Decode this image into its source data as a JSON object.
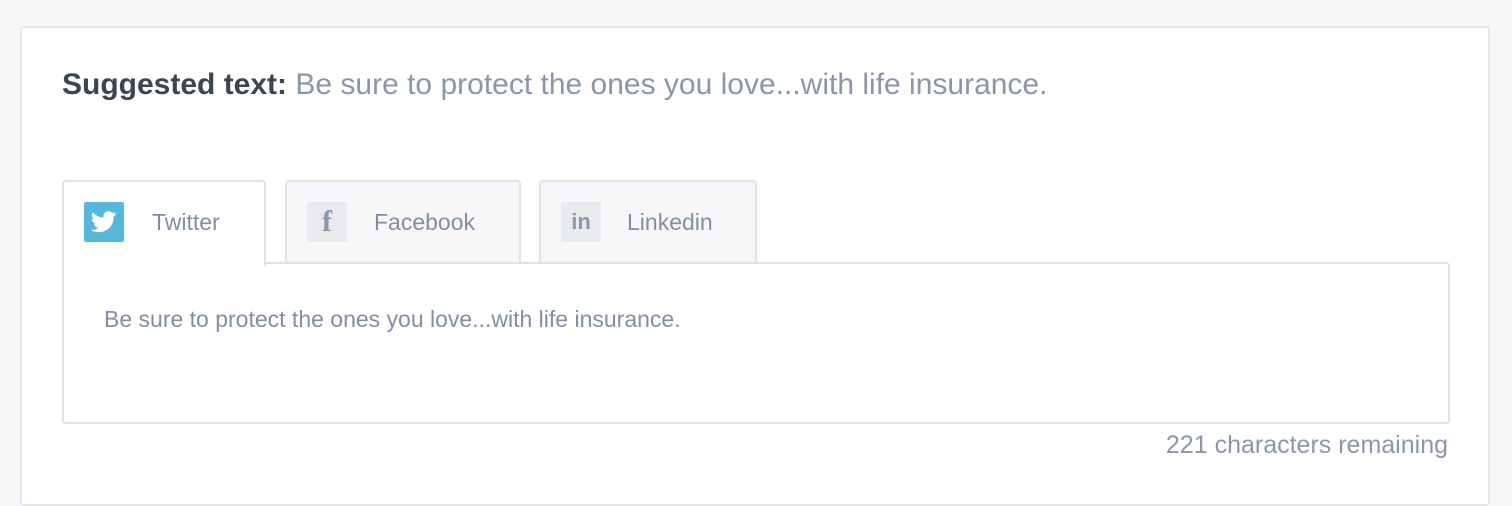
{
  "suggested": {
    "label": "Suggested text:",
    "text": "Be sure to protect the ones you love...with life insurance."
  },
  "tabs": [
    {
      "label": "Twitter",
      "icon": "twitter-icon",
      "active": true,
      "icon_color": "#56b9dc"
    },
    {
      "label": "Facebook",
      "icon": "facebook-icon",
      "active": false,
      "glyph": "f"
    },
    {
      "label": "Linkedin",
      "icon": "linkedin-icon",
      "active": false,
      "glyph": "in"
    }
  ],
  "editor": {
    "value": "Be sure to protect the ones you love...with life insurance."
  },
  "counter": {
    "text": "221 characters remaining"
  },
  "colors": {
    "heading": "#3b4556",
    "muted_text": "#8a96aa",
    "border": "#dfe2ea",
    "twitter_brand": "#56b9dc"
  }
}
